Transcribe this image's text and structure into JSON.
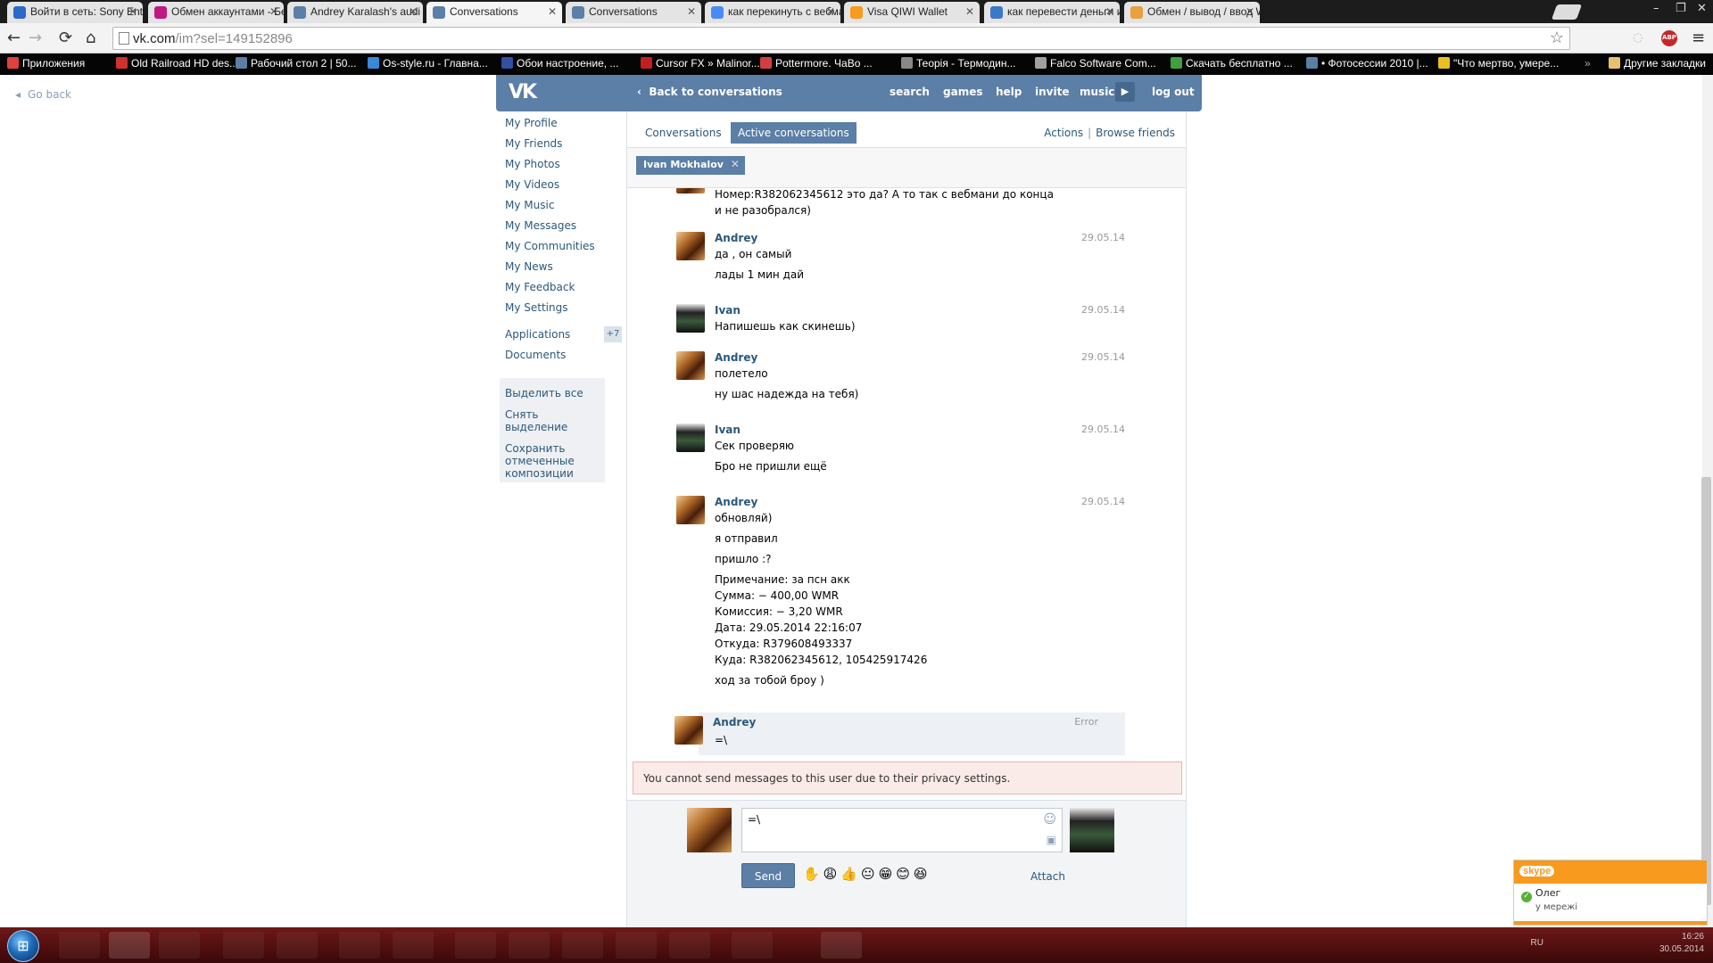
{
  "browser": {
    "tabs": [
      {
        "title": "Войти в сеть: Sony Enterta",
        "color": "#2a6ac8"
      },
      {
        "title": "Обмен аккаунтами - Бес",
        "color": "#c01880"
      },
      {
        "title": "Andrey Karalash's audi",
        "color": "#5b7fa6"
      },
      {
        "title": "Conversations",
        "color": "#5b7fa6"
      },
      {
        "title": "Conversations",
        "color": "#5b7fa6"
      },
      {
        "title": "как перекинуть с вебман",
        "color": "#4a8af4"
      },
      {
        "title": "Visa QIWI Wallet",
        "color": "#f79a1e"
      },
      {
        "title": "как перевести деньги из",
        "color": "#3a78c8"
      },
      {
        "title": "Обмен / вывод / ввод We",
        "color": "#e8a040"
      }
    ],
    "active_tab_index": 3,
    "url_host": "vk.com",
    "url_path": "/im?sel=149152896",
    "window_controls": [
      "–",
      "❐",
      "✕"
    ],
    "bookmarks": [
      {
        "label": "Приложения",
        "color": "#e04040"
      },
      {
        "label": "Old Railroad HD des...",
        "color": "#d03030"
      },
      {
        "label": "Рабочий стол 2 | 50...",
        "color": "#5b7fa6"
      },
      {
        "label": "Os-style.ru - Главна...",
        "color": "#3a88d8"
      },
      {
        "label": "Обои настроение, ...",
        "color": "#3050a0"
      },
      {
        "label": "Cursor FX » Malinor...",
        "color": "#c02020"
      },
      {
        "label": "Pottermore. ЧаВо ...",
        "color": "#d04040"
      },
      {
        "label": "Теорія - Термодин...",
        "color": "#888888"
      },
      {
        "label": "Falco Software Com...",
        "color": "#a0a0a0"
      },
      {
        "label": "Скачать бесплатно ...",
        "color": "#40a040"
      },
      {
        "label": "• Фотосессии 2010 |...",
        "color": "#5b7fa6"
      },
      {
        "label": "\"Что мертво, умере...",
        "color": "#e8c020"
      }
    ],
    "other_bookmarks": "Другие закладки"
  },
  "page": {
    "go_back": "Go back",
    "header": {
      "back_to_conversations": "Back to conversations",
      "links": [
        "search",
        "games",
        "help",
        "invite",
        "music",
        "log out"
      ]
    },
    "left_nav": {
      "items": [
        "My Profile",
        "My Friends",
        "My Photos",
        "My Videos",
        "My Music",
        "My Messages",
        "My Communities",
        "My News",
        "My Feedback",
        "My Settings"
      ],
      "applications": "Applications",
      "applications_badge": "+7",
      "documents": "Documents",
      "actions": [
        "Выделить все",
        "Снять выделение",
        "Сохранить отмеченные композиции"
      ]
    },
    "tabs": {
      "conversations": "Conversations",
      "active": "Active conversations",
      "actions": "Actions",
      "browse_friends": "Browse friends"
    },
    "peer": "Ivan Mokhalov",
    "messages": [
      {
        "author": "",
        "date": "",
        "lines": [
          "Номер:R382062345612 это да? А то так с вебмани до конца",
          "и не разобрался)"
        ]
      },
      {
        "author": "Andrey",
        "date": "29.05.14",
        "lines": [
          "да , он самый",
          "",
          "лады 1 мин дай"
        ]
      },
      {
        "author": "Ivan",
        "date": "29.05.14",
        "lines": [
          "Напишешь как скинешь)"
        ]
      },
      {
        "author": "Andrey",
        "date": "29.05.14",
        "lines": [
          "полетело",
          "",
          "ну шас надежда на тебя)"
        ]
      },
      {
        "author": "Ivan",
        "date": "29.05.14",
        "lines": [
          "Сек проверяю",
          "",
          "Бро не пришли ещё"
        ]
      },
      {
        "author": "Andrey",
        "date": "29.05.14",
        "lines": [
          "обновляй)",
          "",
          "я отправил",
          "",
          "пришло :?",
          "",
          "Примечание: за псн акк",
          "Сумма: − 400,00 WMR",
          "Комиссия: − 3,20 WMR",
          "Дата: 29.05.2014 22:16:07",
          "Откуда: R379608493337",
          "Куда: R382062345612, 105425917426",
          "",
          "ход за тобой броу )"
        ]
      },
      {
        "author": "Andrey",
        "date": "Error",
        "lines": [
          "=\\"
        ]
      }
    ],
    "privacy_notice": "You cannot send messages to this user due to their privacy settings.",
    "composer": {
      "draft": "=\\",
      "send": "Send",
      "attach": "Attach",
      "emojis": "✋😩👍😐😁😊😆"
    }
  },
  "skype": {
    "brand": "skype",
    "contact": "Олег",
    "status": "у мережі"
  },
  "taskbar": {
    "lang": "RU",
    "time": "16:26",
    "date": "30.05.2014"
  }
}
